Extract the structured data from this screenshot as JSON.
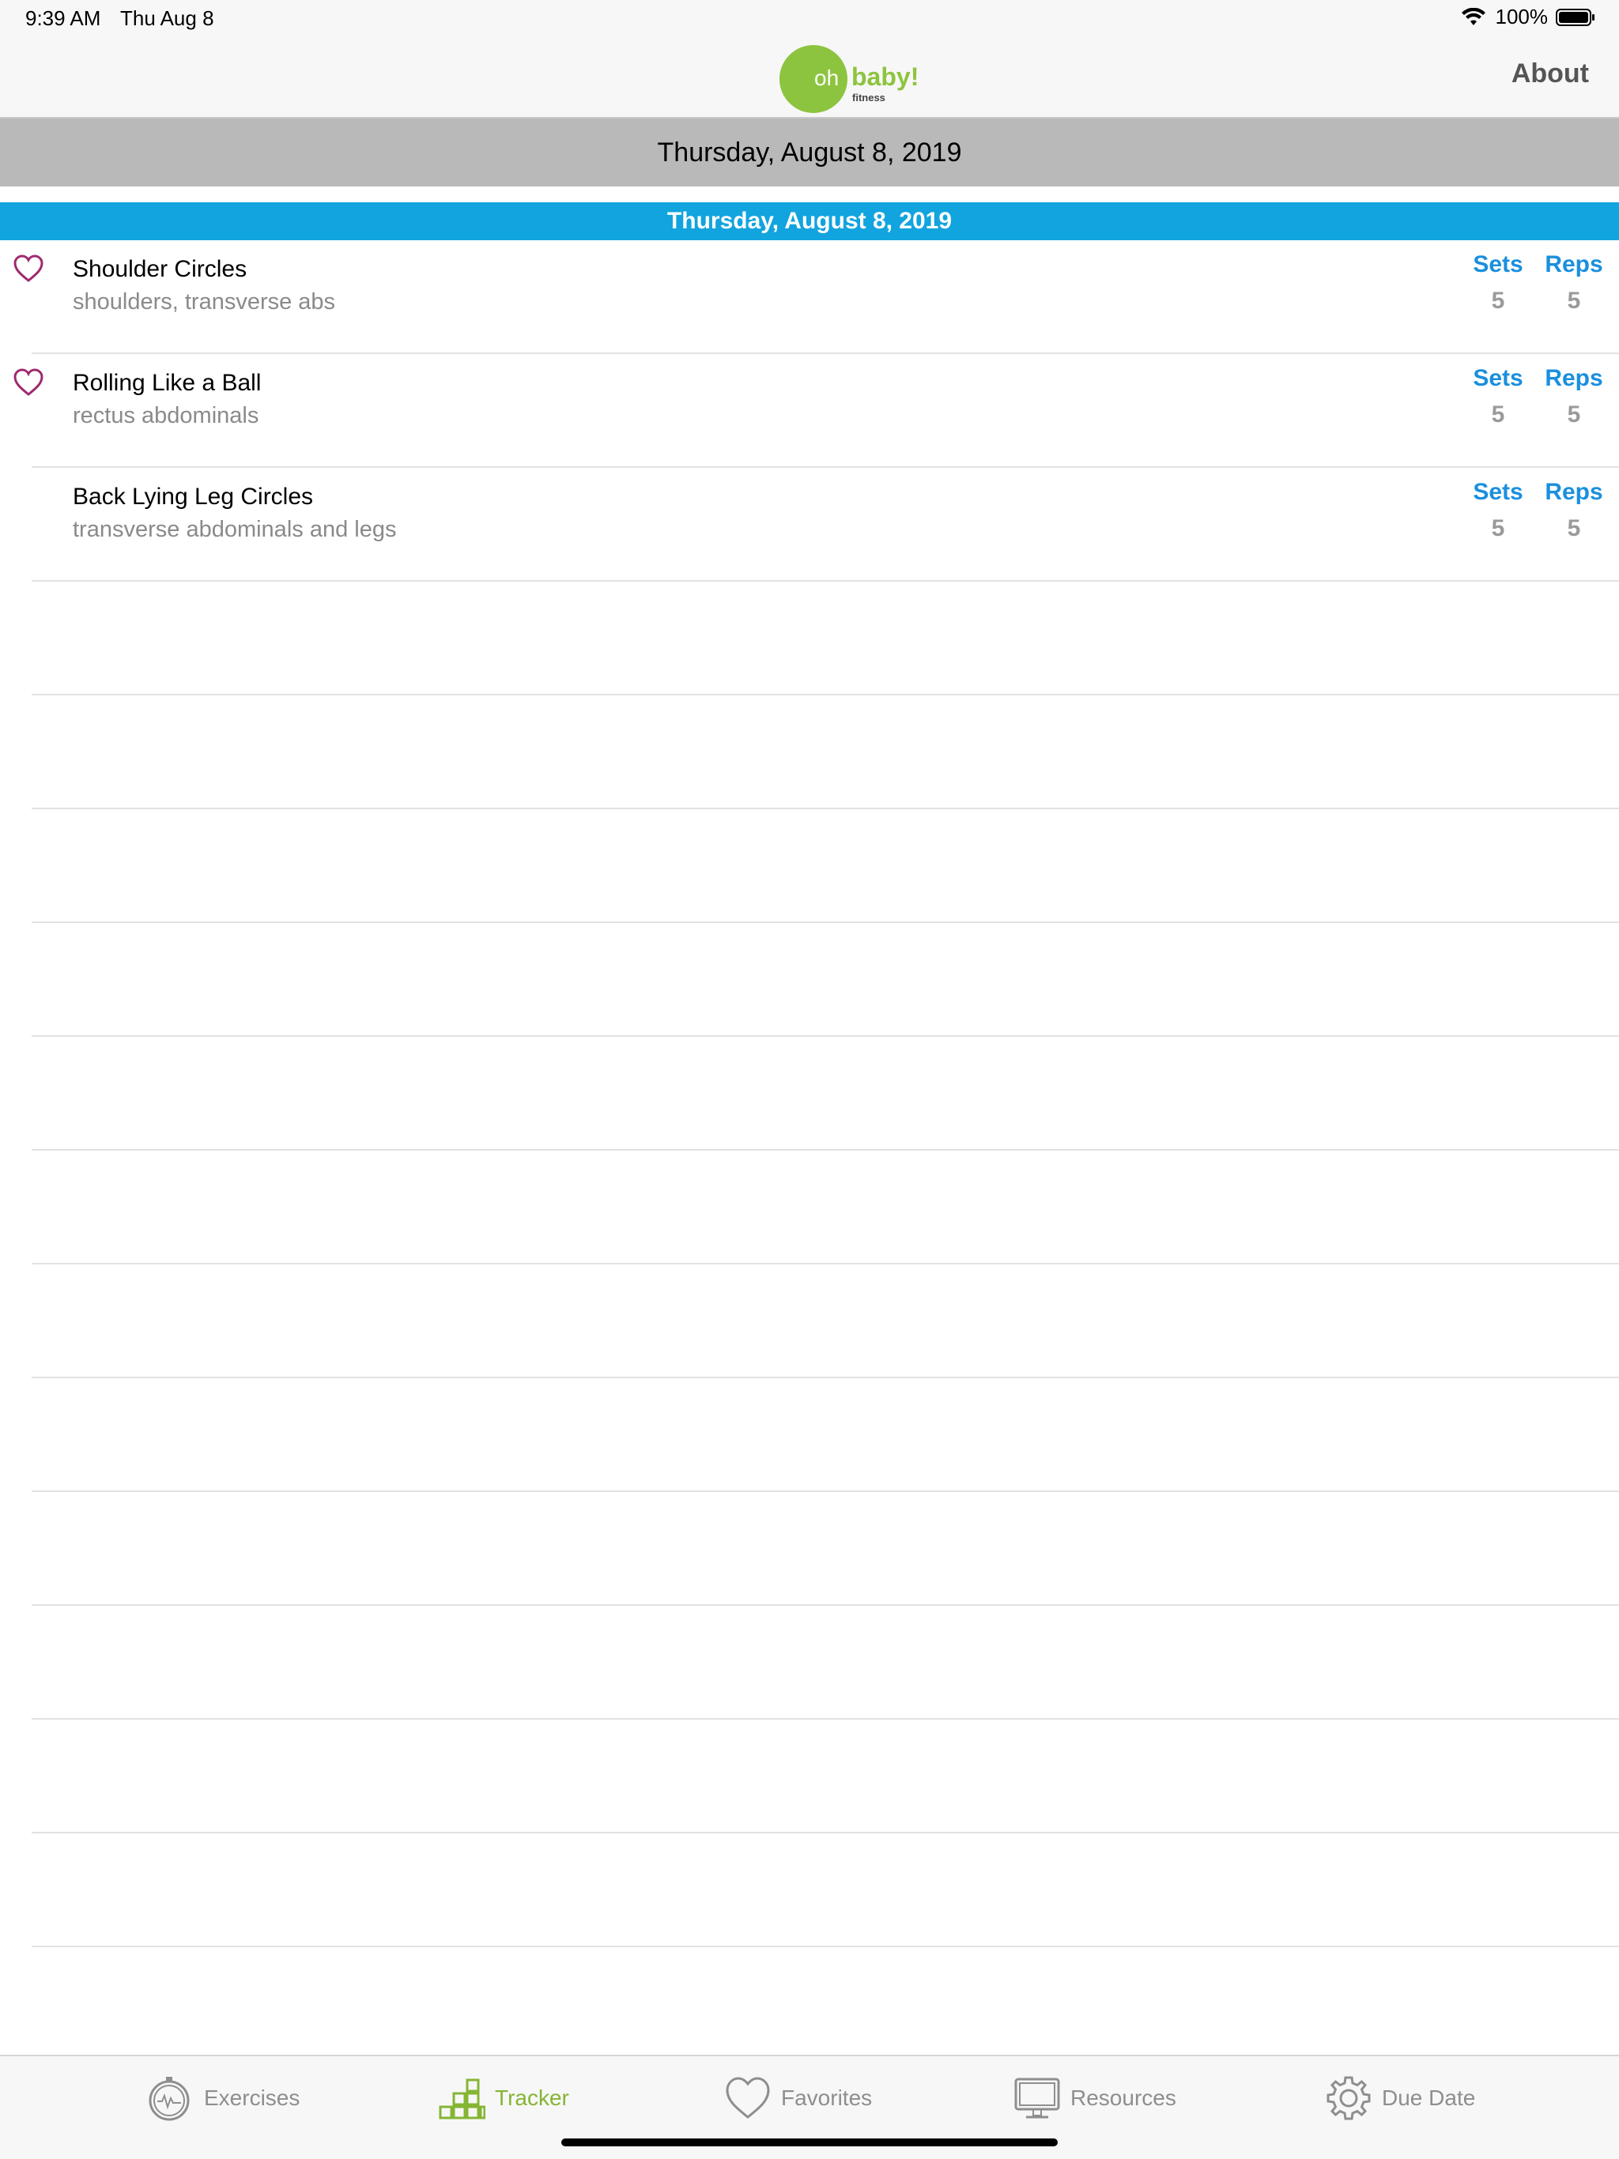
{
  "status_bar": {
    "time": "9:39 AM",
    "date": "Thu Aug 8",
    "battery": "100%"
  },
  "nav": {
    "logo_oh": "oh",
    "logo_baby": "baby!",
    "logo_fitness": "fitness",
    "about_label": "About"
  },
  "date_banner": "Thursday, August 8, 2019",
  "section_header": "Thursday, August 8, 2019",
  "exercises": [
    {
      "title": "Shoulder Circles",
      "subtitle": "shoulders, transverse abs",
      "favorite": true,
      "sets_label": "Sets",
      "reps_label": "Reps",
      "sets": "5",
      "reps": "5"
    },
    {
      "title": "Rolling Like a Ball",
      "subtitle": "rectus abdominals",
      "favorite": true,
      "sets_label": "Sets",
      "reps_label": "Reps",
      "sets": "5",
      "reps": "5"
    },
    {
      "title": "Back Lying Leg Circles",
      "subtitle": "transverse abdominals and legs",
      "favorite": false,
      "sets_label": "Sets",
      "reps_label": "Reps",
      "sets": "5",
      "reps": "5"
    }
  ],
  "tabs": [
    {
      "label": "Exercises",
      "icon": "stopwatch-icon",
      "active": false
    },
    {
      "label": "Tracker",
      "icon": "blocks-icon",
      "active": true
    },
    {
      "label": "Favorites",
      "icon": "heart-icon",
      "active": false
    },
    {
      "label": "Resources",
      "icon": "monitor-icon",
      "active": false
    },
    {
      "label": "Due Date",
      "icon": "gear-icon",
      "active": false
    }
  ],
  "colors": {
    "accent_blue": "#12a4de",
    "link_blue": "#1a8fde",
    "brand_green": "#86b534",
    "heart_purple": "#9e2a6e",
    "banner_gray": "#b9b9b9"
  }
}
